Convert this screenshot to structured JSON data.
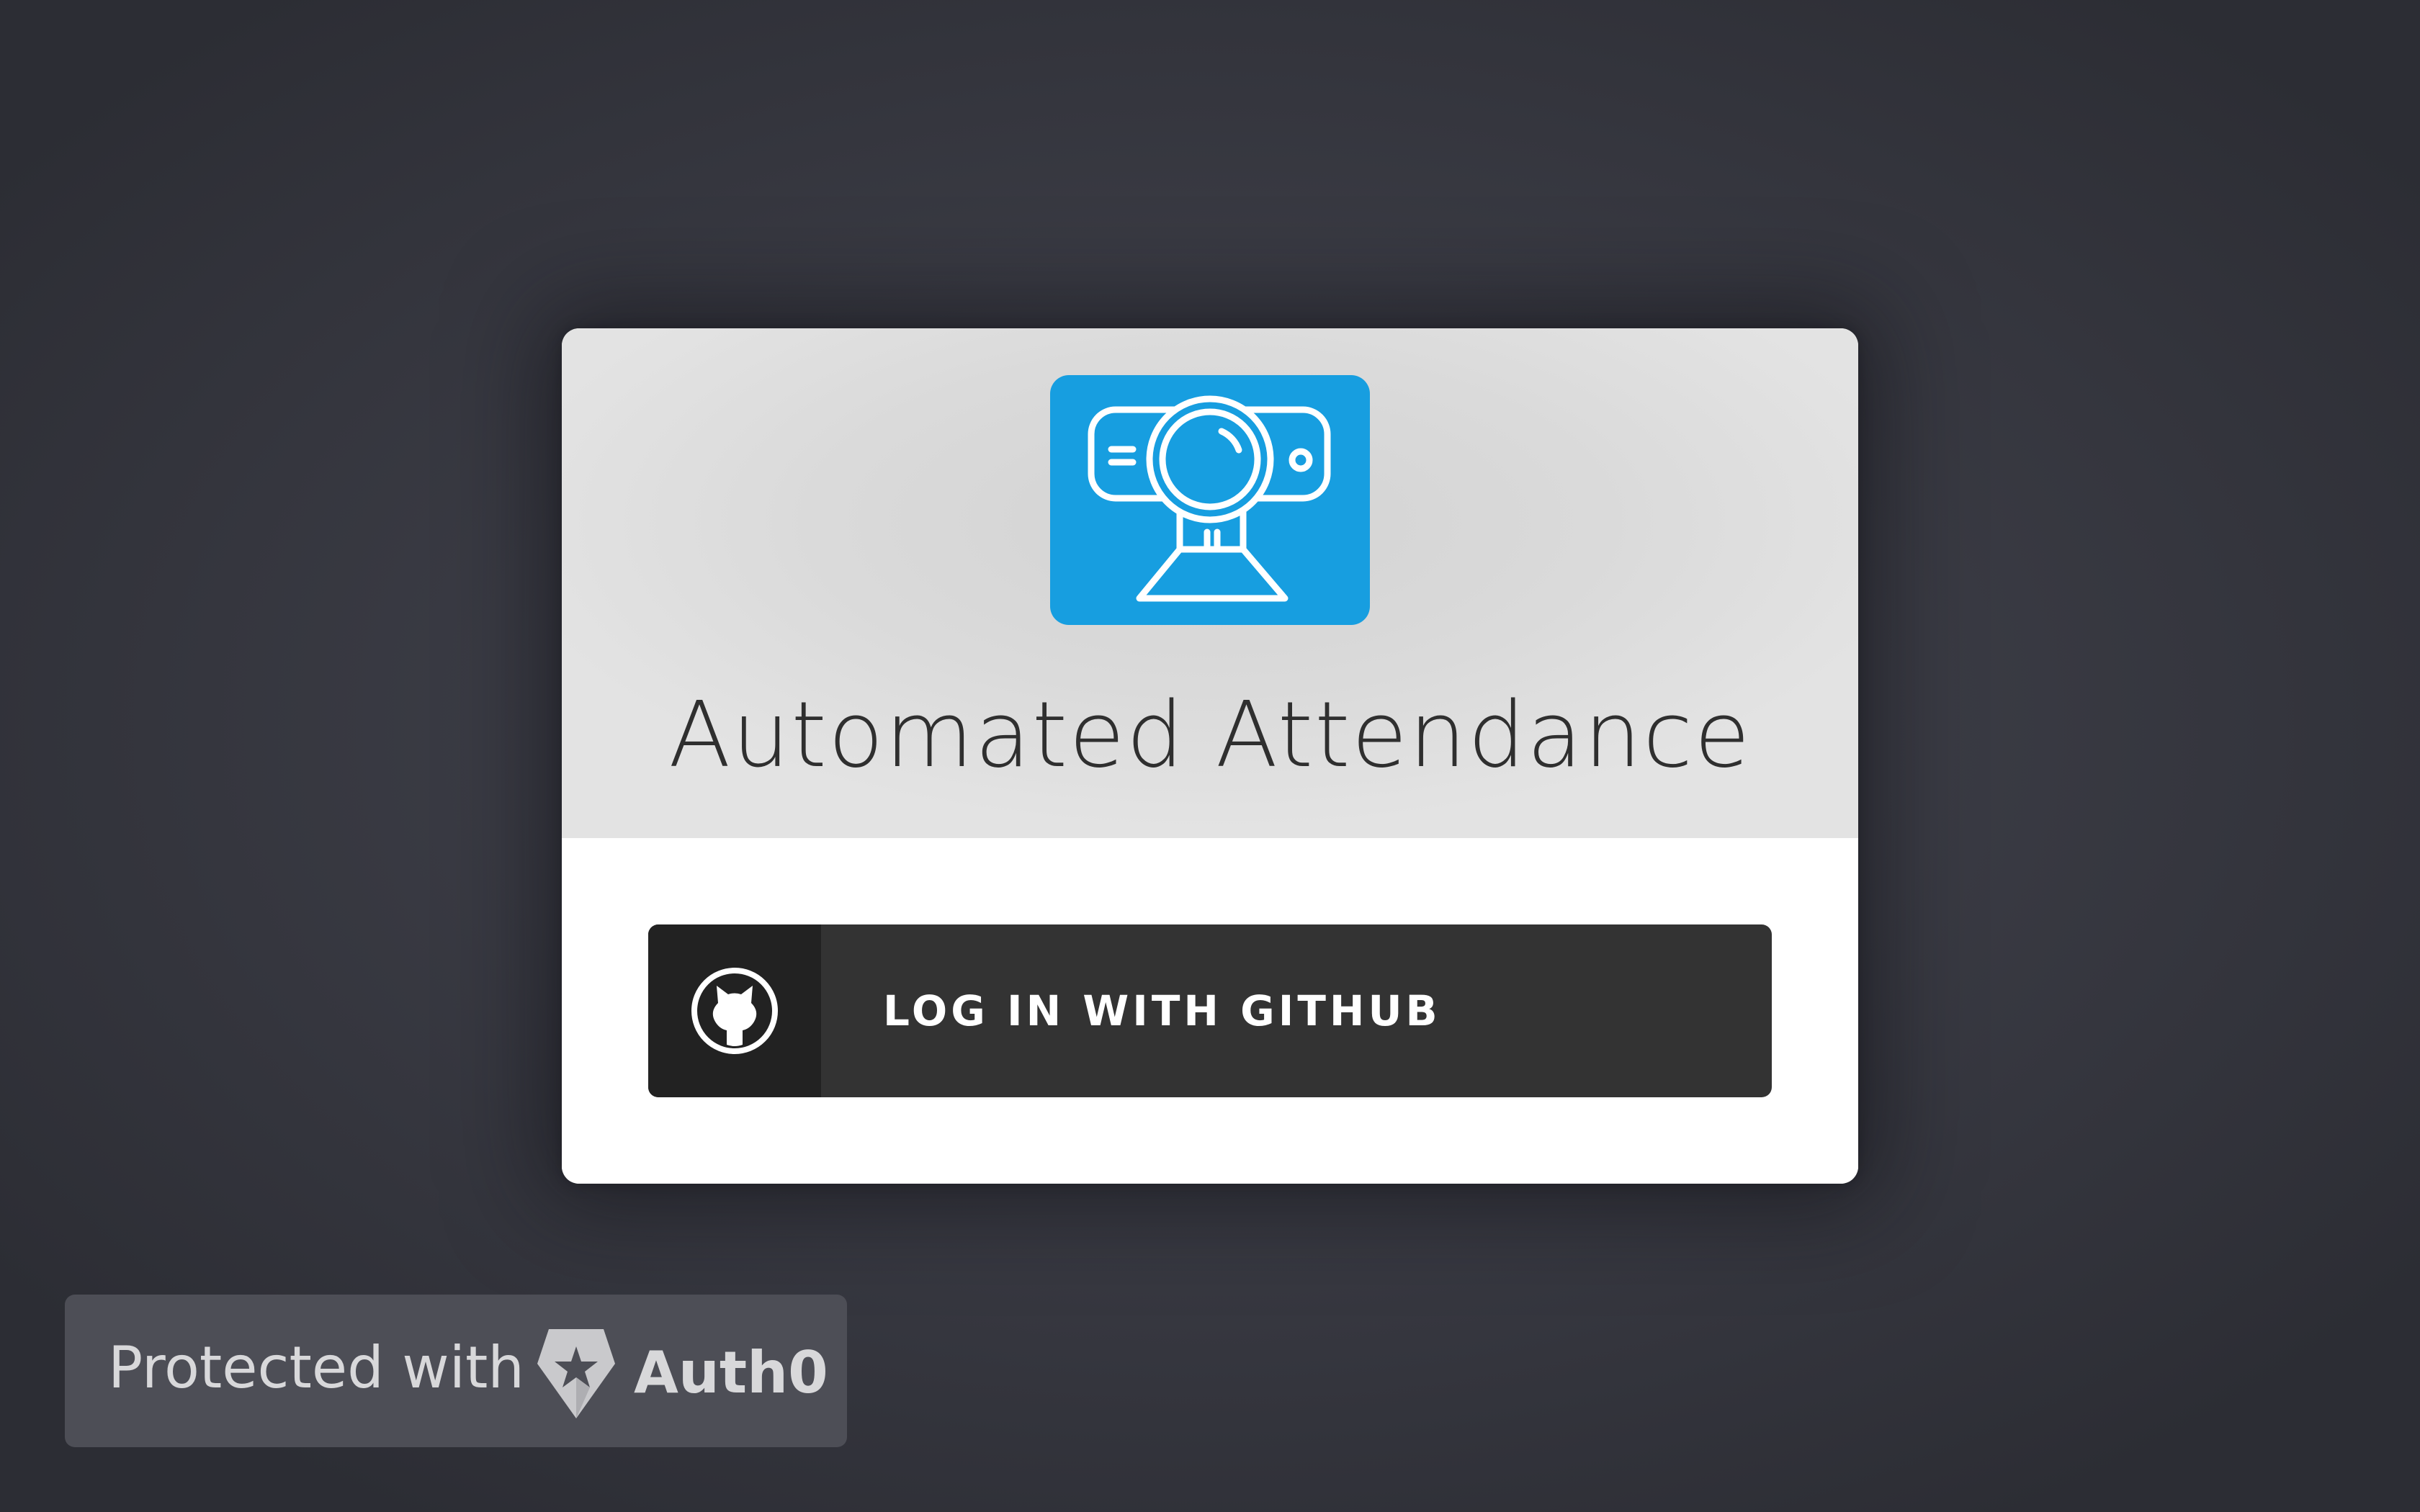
{
  "page": {
    "background": "#3a3b44"
  },
  "card": {
    "logo_icon": "webcam-icon",
    "logo_color": "#179ee0",
    "title": "Automated Attendance"
  },
  "login": {
    "icon": "github-icon",
    "label": "LOG IN WITH GITHUB",
    "button_color": "#333333"
  },
  "badge": {
    "text": "Protected with",
    "icon": "auth0-shield-icon",
    "brand": "Auth0"
  }
}
